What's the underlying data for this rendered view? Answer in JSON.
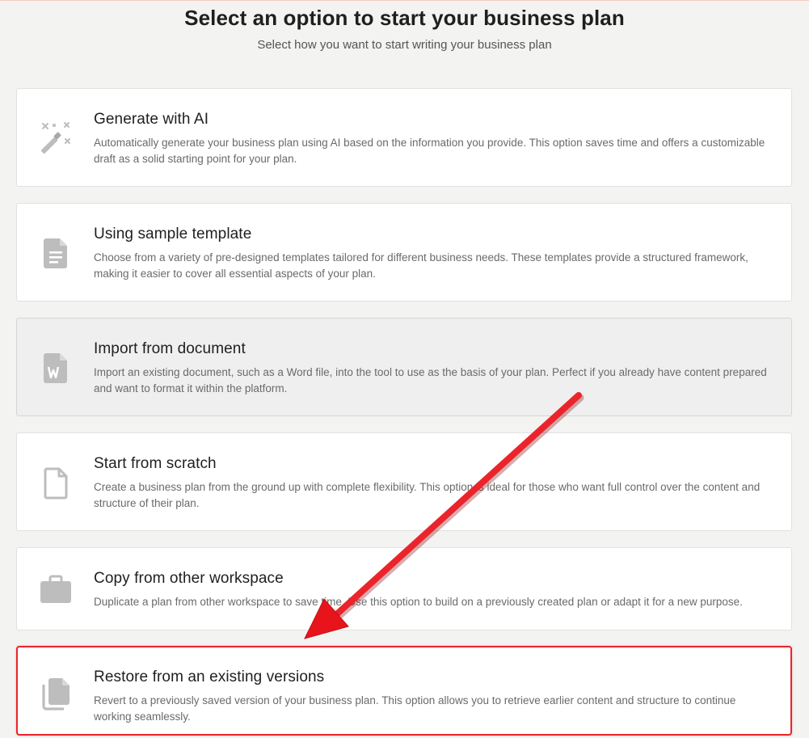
{
  "header": {
    "title": "Select an option to start your business plan",
    "subtitle": "Select how you want to start writing your business plan"
  },
  "options": [
    {
      "title": "Generate with AI",
      "description": "Automatically generate your business plan using AI based on the information you provide. This option saves time and offers a customizable draft as a solid starting point for your plan.",
      "icon": "magic-wand-icon"
    },
    {
      "title": "Using sample template",
      "description": "Choose from a variety of pre-designed templates tailored for different business needs. These templates provide a structured framework, making it easier to cover all essential aspects of your plan.",
      "icon": "document-icon"
    },
    {
      "title": "Import from document",
      "description": "Import an existing document, such as a Word file, into the tool to use as the basis of your plan. Perfect if you already have content prepared and want to format it within the platform.",
      "icon": "word-document-icon",
      "state": "hovered"
    },
    {
      "title": "Start from scratch",
      "description": "Create a business plan from the ground up with complete flexibility. This option is ideal for those who want full control over the content and structure of their plan.",
      "icon": "blank-page-icon"
    },
    {
      "title": "Copy from other workspace",
      "description": "Duplicate a plan from other workspace to save time. Use this option to build on a previously created plan or adapt it for a new purpose.",
      "icon": "briefcase-icon"
    },
    {
      "title": "Restore from an existing versions",
      "description": "Revert to a previously saved version of your business plan. This option allows you to retrieve earlier content and structure to continue working seamlessly.",
      "icon": "copy-documents-icon",
      "state": "highlighted"
    }
  ],
  "colors": {
    "background": "#f3f3f2",
    "card": "#ffffff",
    "card_hover": "#efefef",
    "icon": "#bdbdbd",
    "highlight_red": "#e8262b",
    "annotation_arrow": "#e8141c"
  },
  "annotation": {
    "icon": "red-arrow-annotation",
    "points_to": "Restore from an existing versions"
  }
}
